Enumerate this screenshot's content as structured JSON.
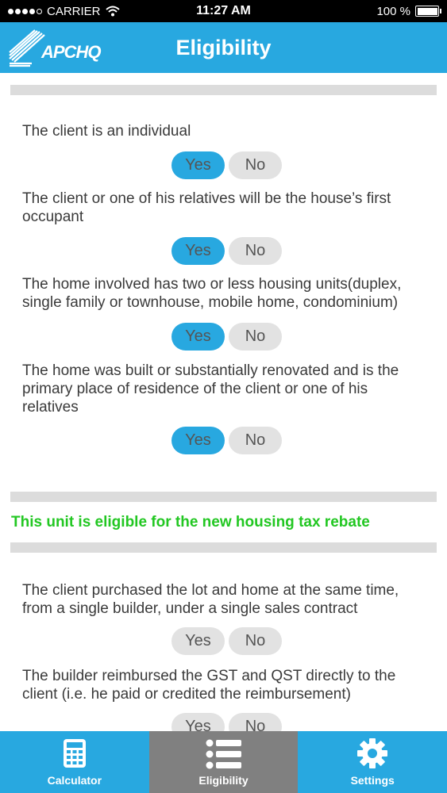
{
  "status_bar": {
    "carrier": "CARRIER",
    "time": "11:27 AM",
    "battery": "100 %",
    "battery_level": 1.0
  },
  "header": {
    "logo_text": "APCHQ",
    "title": "Eligibility"
  },
  "colors": {
    "accent": "#28a8e0",
    "eligible_text": "#22c722",
    "button_off": "#e2e2e2",
    "tab_active": "#808080"
  },
  "questions": [
    {
      "text": "The client is an individual",
      "yes": "Yes",
      "no": "No",
      "selected": "yes"
    },
    {
      "text": "The client or one of his relatives will be the house’s first occupant",
      "yes": "Yes",
      "no": "No",
      "selected": "yes"
    },
    {
      "text": "The home involved has two or less housing units(duplex, single family or townhouse, mobile home, condominium)",
      "yes": "Yes",
      "no": "No",
      "selected": "yes"
    },
    {
      "text": "The home was built or substantially renovated and is the primary place of residence of the client or one of his relatives",
      "yes": "Yes",
      "no": "No",
      "selected": "yes"
    }
  ],
  "result": "This unit is eligible for the new housing tax rebate",
  "questions2": [
    {
      "text": "The client purchased the lot and home at the same time, from a single builder, under a single sales contract",
      "yes": "Yes",
      "no": "No",
      "selected": "none"
    },
    {
      "text": "The builder reimbursed the GST and QST directly to the client (i.e. he paid or credited the reimbursement)",
      "yes": "Yes",
      "no": "No",
      "selected": "none"
    }
  ],
  "tabs": [
    {
      "label": "Calculator",
      "icon": "calculator-icon",
      "active": false
    },
    {
      "label": "Eligibility",
      "icon": "list-icon",
      "active": true
    },
    {
      "label": "Settings",
      "icon": "gear-icon",
      "active": false
    }
  ]
}
